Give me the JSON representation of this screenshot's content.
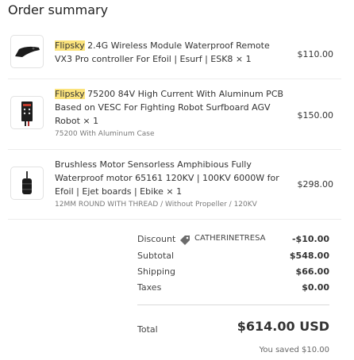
{
  "title": "Order summary",
  "items": [
    {
      "brand": "Flipsky",
      "name": " 2.4G Wireless Module Waterproof Remote VX3 Pro controller For Efoil | Esurf | ESK8 × 1",
      "variant": "",
      "price": "$110.00",
      "thumb_icon": "remote-controller-image"
    },
    {
      "brand": "Flipsky",
      "name": " 75200 84V High Current With Aluminum PCB Based on VESC For Fighting Robot Surfboard AGV Robot × 1",
      "variant": "75200 With Aluminum Case",
      "price": "$150.00",
      "thumb_icon": "vesc-controller-image"
    },
    {
      "brand": "",
      "name": "Brushless Motor Sensorless Amphibious Fully Waterproof motor 65161 120KV | 100KV 6000W for Efoil | Ejet boards | Ebike × 1",
      "variant": "12MM ROUND WITH THREAD / Without Propeller / 120KV",
      "price": "$298.00",
      "thumb_icon": "motor-image"
    }
  ],
  "summary": {
    "discount_label": "Discount",
    "discount_code": "CATHERINETRESA",
    "discount_value": "-$10.00",
    "subtotal_label": "Subtotal",
    "subtotal_value": "$548.00",
    "shipping_label": "Shipping",
    "shipping_value": "$66.00",
    "taxes_label": "Taxes",
    "taxes_value": "$0.00",
    "total_label": "Total",
    "total_value": "$614.00 USD",
    "saved_text": "You saved $10.00"
  },
  "colors": {
    "highlight": "#fbe37c",
    "text": "#333333",
    "muted": "#7a7a7a"
  }
}
